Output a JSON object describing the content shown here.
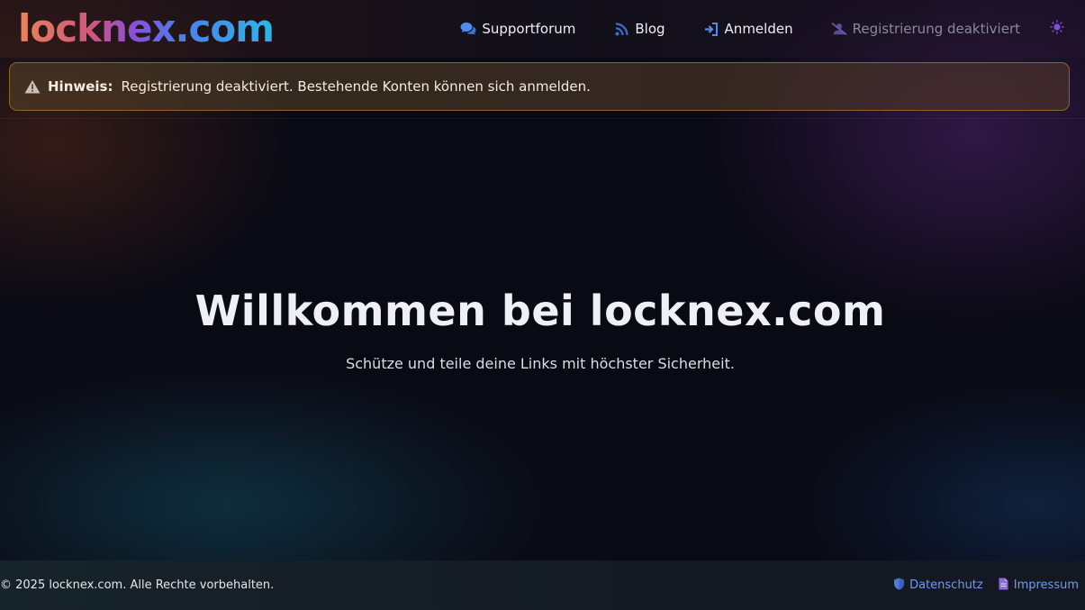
{
  "header": {
    "logo": "locknex.com",
    "nav": {
      "support": "Supportforum",
      "blog": "Blog",
      "login": "Anmelden",
      "register_disabled": "Registrierung deaktiviert"
    },
    "icons": {
      "support": "chat-bubbles-icon",
      "blog": "rss-icon",
      "login": "sign-in-icon",
      "register_disabled": "user-slash-icon",
      "theme": "sun-icon"
    }
  },
  "notice": {
    "label": "Hinweis:",
    "text": "Registrierung deaktiviert. Bestehende Konten können sich anmelden.",
    "icon": "warning-triangle-icon"
  },
  "hero": {
    "title": "Willkommen bei locknex.com",
    "subtitle": "Schütze und teile deine Links mit höchster Sicherheit."
  },
  "footer": {
    "copyright": "© 2025 locknex.com. Alle Rechte vorbehalten.",
    "privacy": "Datenschutz",
    "imprint": "Impressum"
  },
  "colors": {
    "accent_blue": "#4f8cf0",
    "warning_border": "#8a6428",
    "link": "#6e9cf0",
    "theme_icon": "#7b4fd6"
  }
}
